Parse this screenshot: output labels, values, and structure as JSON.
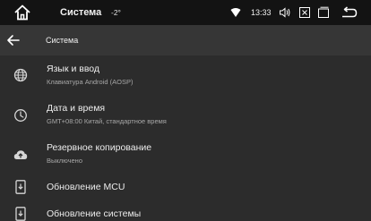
{
  "status_bar": {
    "title": "Система",
    "temperature": "-2°",
    "time": "13:33",
    "icons": [
      "home-icon",
      "wifi-icon",
      "volume-icon",
      "close-box-icon",
      "windows-icon",
      "back-arrow-icon"
    ]
  },
  "header": {
    "title": "Система",
    "back_icon": "arrow-left-icon"
  },
  "settings": [
    {
      "icon": "globe-icon",
      "title": "Язык и ввод",
      "subtitle": "Клавиатура Android (AOSP)"
    },
    {
      "icon": "clock-icon",
      "title": "Дата и время",
      "subtitle": "GMT+08:00 Китай, стандартное время"
    },
    {
      "icon": "cloud-upload-icon",
      "title": "Резервное копирование",
      "subtitle": "Выключено"
    },
    {
      "icon": "system-update-icon",
      "title": "Обновление MCU",
      "subtitle": ""
    },
    {
      "icon": "system-update-icon",
      "title": "Обновление системы",
      "subtitle": ""
    }
  ],
  "colors": {
    "status_bar_bg": "#131313",
    "header_bg": "#363636",
    "list_bg": "#2c2c2c",
    "text_primary": "#ececec",
    "text_secondary": "#a8a8a8"
  }
}
